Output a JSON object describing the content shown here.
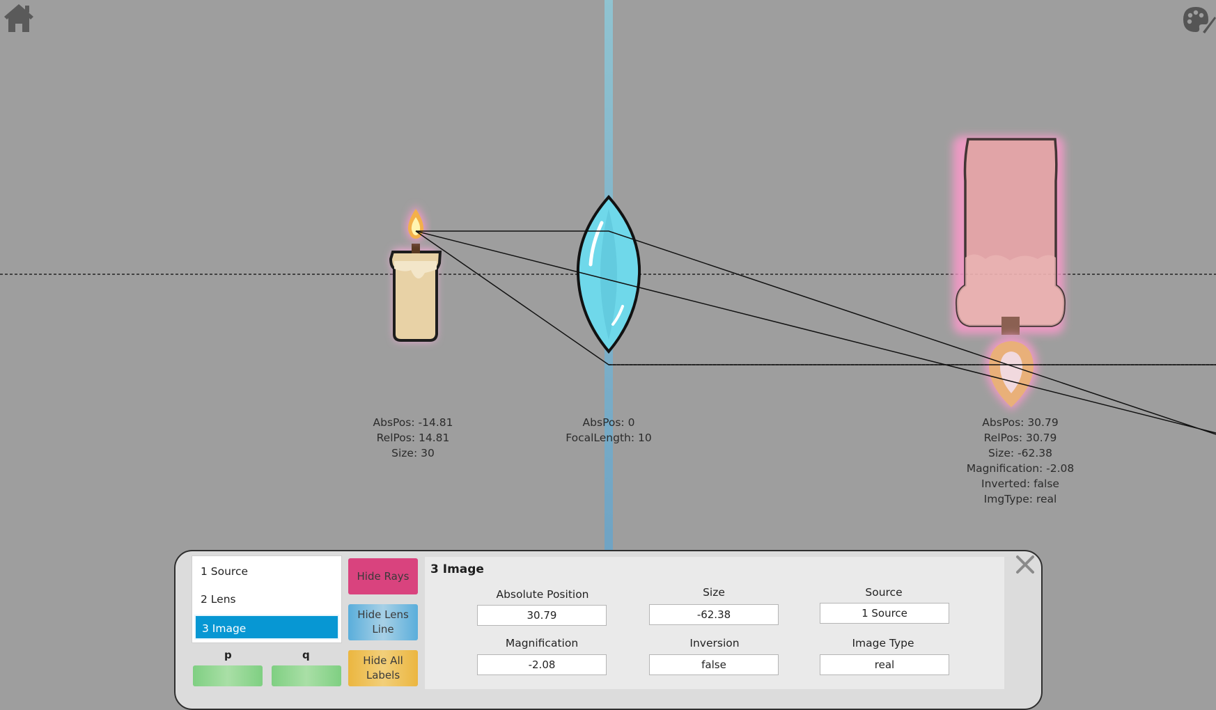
{
  "toolbar": {
    "home_icon": "home-icon",
    "theme_icon": "palette-icon"
  },
  "scene": {
    "source": {
      "icon": "candle-icon",
      "info": [
        "AbsPos: -14.81",
        "RelPos: 14.81",
        "Size: 30"
      ]
    },
    "lens": {
      "icon": "convex-lens-icon",
      "info": [
        "AbsPos: 0",
        "FocalLength: 10"
      ]
    },
    "image": {
      "icon": "inverted-candle-icon",
      "info": [
        "AbsPos: 30.79",
        "RelPos: 30.79",
        "Size: -62.38",
        "Magnification: -2.08",
        "Inverted: false",
        "ImgType: real"
      ]
    }
  },
  "panel": {
    "list": [
      {
        "label": "1 Source",
        "selected": false
      },
      {
        "label": "2 Lens",
        "selected": false
      },
      {
        "label": "3 Image",
        "selected": true
      }
    ],
    "p_label": "p",
    "q_label": "q",
    "buttons": {
      "hide_rays": "Hide Rays",
      "hide_lens_line": "Hide Lens Line",
      "hide_all_labels": "Hide All Labels"
    },
    "detail": {
      "title": "3 Image",
      "fields": {
        "absolute_position": {
          "label": "Absolute Position",
          "value": "30.79"
        },
        "size": {
          "label": "Size",
          "value": "-62.38"
        },
        "source": {
          "label": "Source",
          "value": "1 Source"
        },
        "magnification": {
          "label": "Magnification",
          "value": "-2.08"
        },
        "inversion": {
          "label": "Inversion",
          "value": "false"
        },
        "image_type": {
          "label": "Image Type",
          "value": "real"
        }
      }
    },
    "close_icon": "close-icon"
  },
  "colors": {
    "background": "#9e9e9e",
    "lens": "#6fd8ea",
    "selected": "#0797d3",
    "hide_rays": "#d9437e",
    "hide_lens_line": "#5aaedb",
    "hide_all_labels": "#ebb640",
    "pq": "#8fd68f"
  }
}
